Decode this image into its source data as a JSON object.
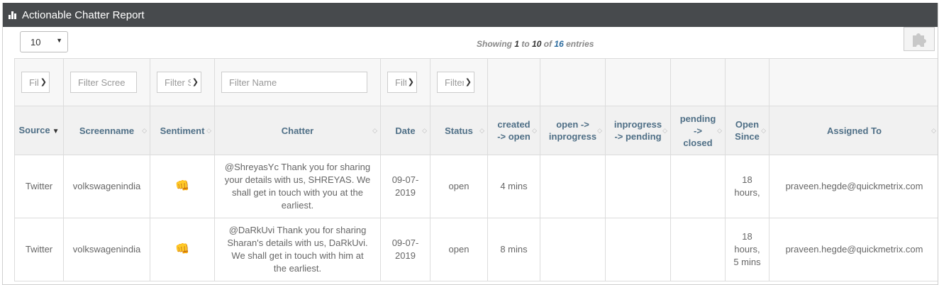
{
  "header": {
    "title": "Actionable Chatter Report"
  },
  "length_select": {
    "value": "10"
  },
  "info": {
    "prefix": "Showing",
    "start": "1",
    "to": "to",
    "end": "10",
    "of": "of",
    "total": "16",
    "suffix": "entries"
  },
  "filters": {
    "source": "Filt",
    "screenname": "Filter Scree",
    "sentiment": "Filter S",
    "name": "Filter Name",
    "date": "Filt",
    "status": "Filter"
  },
  "columns": {
    "source": "Source",
    "screenname": "Screenname",
    "sentiment": "Sentiment",
    "chatter": "Chatter",
    "date": "Date",
    "status": "Status",
    "created_open_1": "created",
    "created_open_2": "-> open",
    "open_inprogress_1": "open ->",
    "open_inprogress_2": "inprogress",
    "inprogress_pending_1": "inprogress",
    "inprogress_pending_2": "-> pending",
    "pending_closed_1": "pending",
    "pending_closed_2": "->",
    "pending_closed_3": "closed",
    "open_since_1": "Open",
    "open_since_2": "Since",
    "assigned_to": "Assigned To"
  },
  "rows": [
    {
      "source": "Twitter",
      "screenname": "volkswagenindia",
      "sentiment_icon": "thumb-icon",
      "chatter": [
        "@ShreyasYc Thank you for sharing",
        "your details with us, SHREYAS. We",
        "shall get in touch with you at the",
        "earliest."
      ],
      "date": [
        "09-07-",
        "2019"
      ],
      "status": "open",
      "created_open": "4 mins",
      "open_since": [
        "18",
        "hours,"
      ],
      "assigned_to": "praveen.hegde@quickmetrix.com"
    },
    {
      "source": "Twitter",
      "screenname": "volkswagenindia",
      "sentiment_icon": "thumb-icon",
      "chatter": [
        "@DaRkUvi Thank you for sharing",
        "Sharan's details with us, DaRkUvi.",
        "We shall get in touch with him at",
        "the earliest."
      ],
      "date": [
        "09-07-",
        "2019"
      ],
      "status": "open",
      "created_open": "8 mins",
      "open_since": [
        "18",
        "hours,",
        "5 mins"
      ],
      "assigned_to": "praveen.hegde@quickmetrix.com"
    }
  ]
}
